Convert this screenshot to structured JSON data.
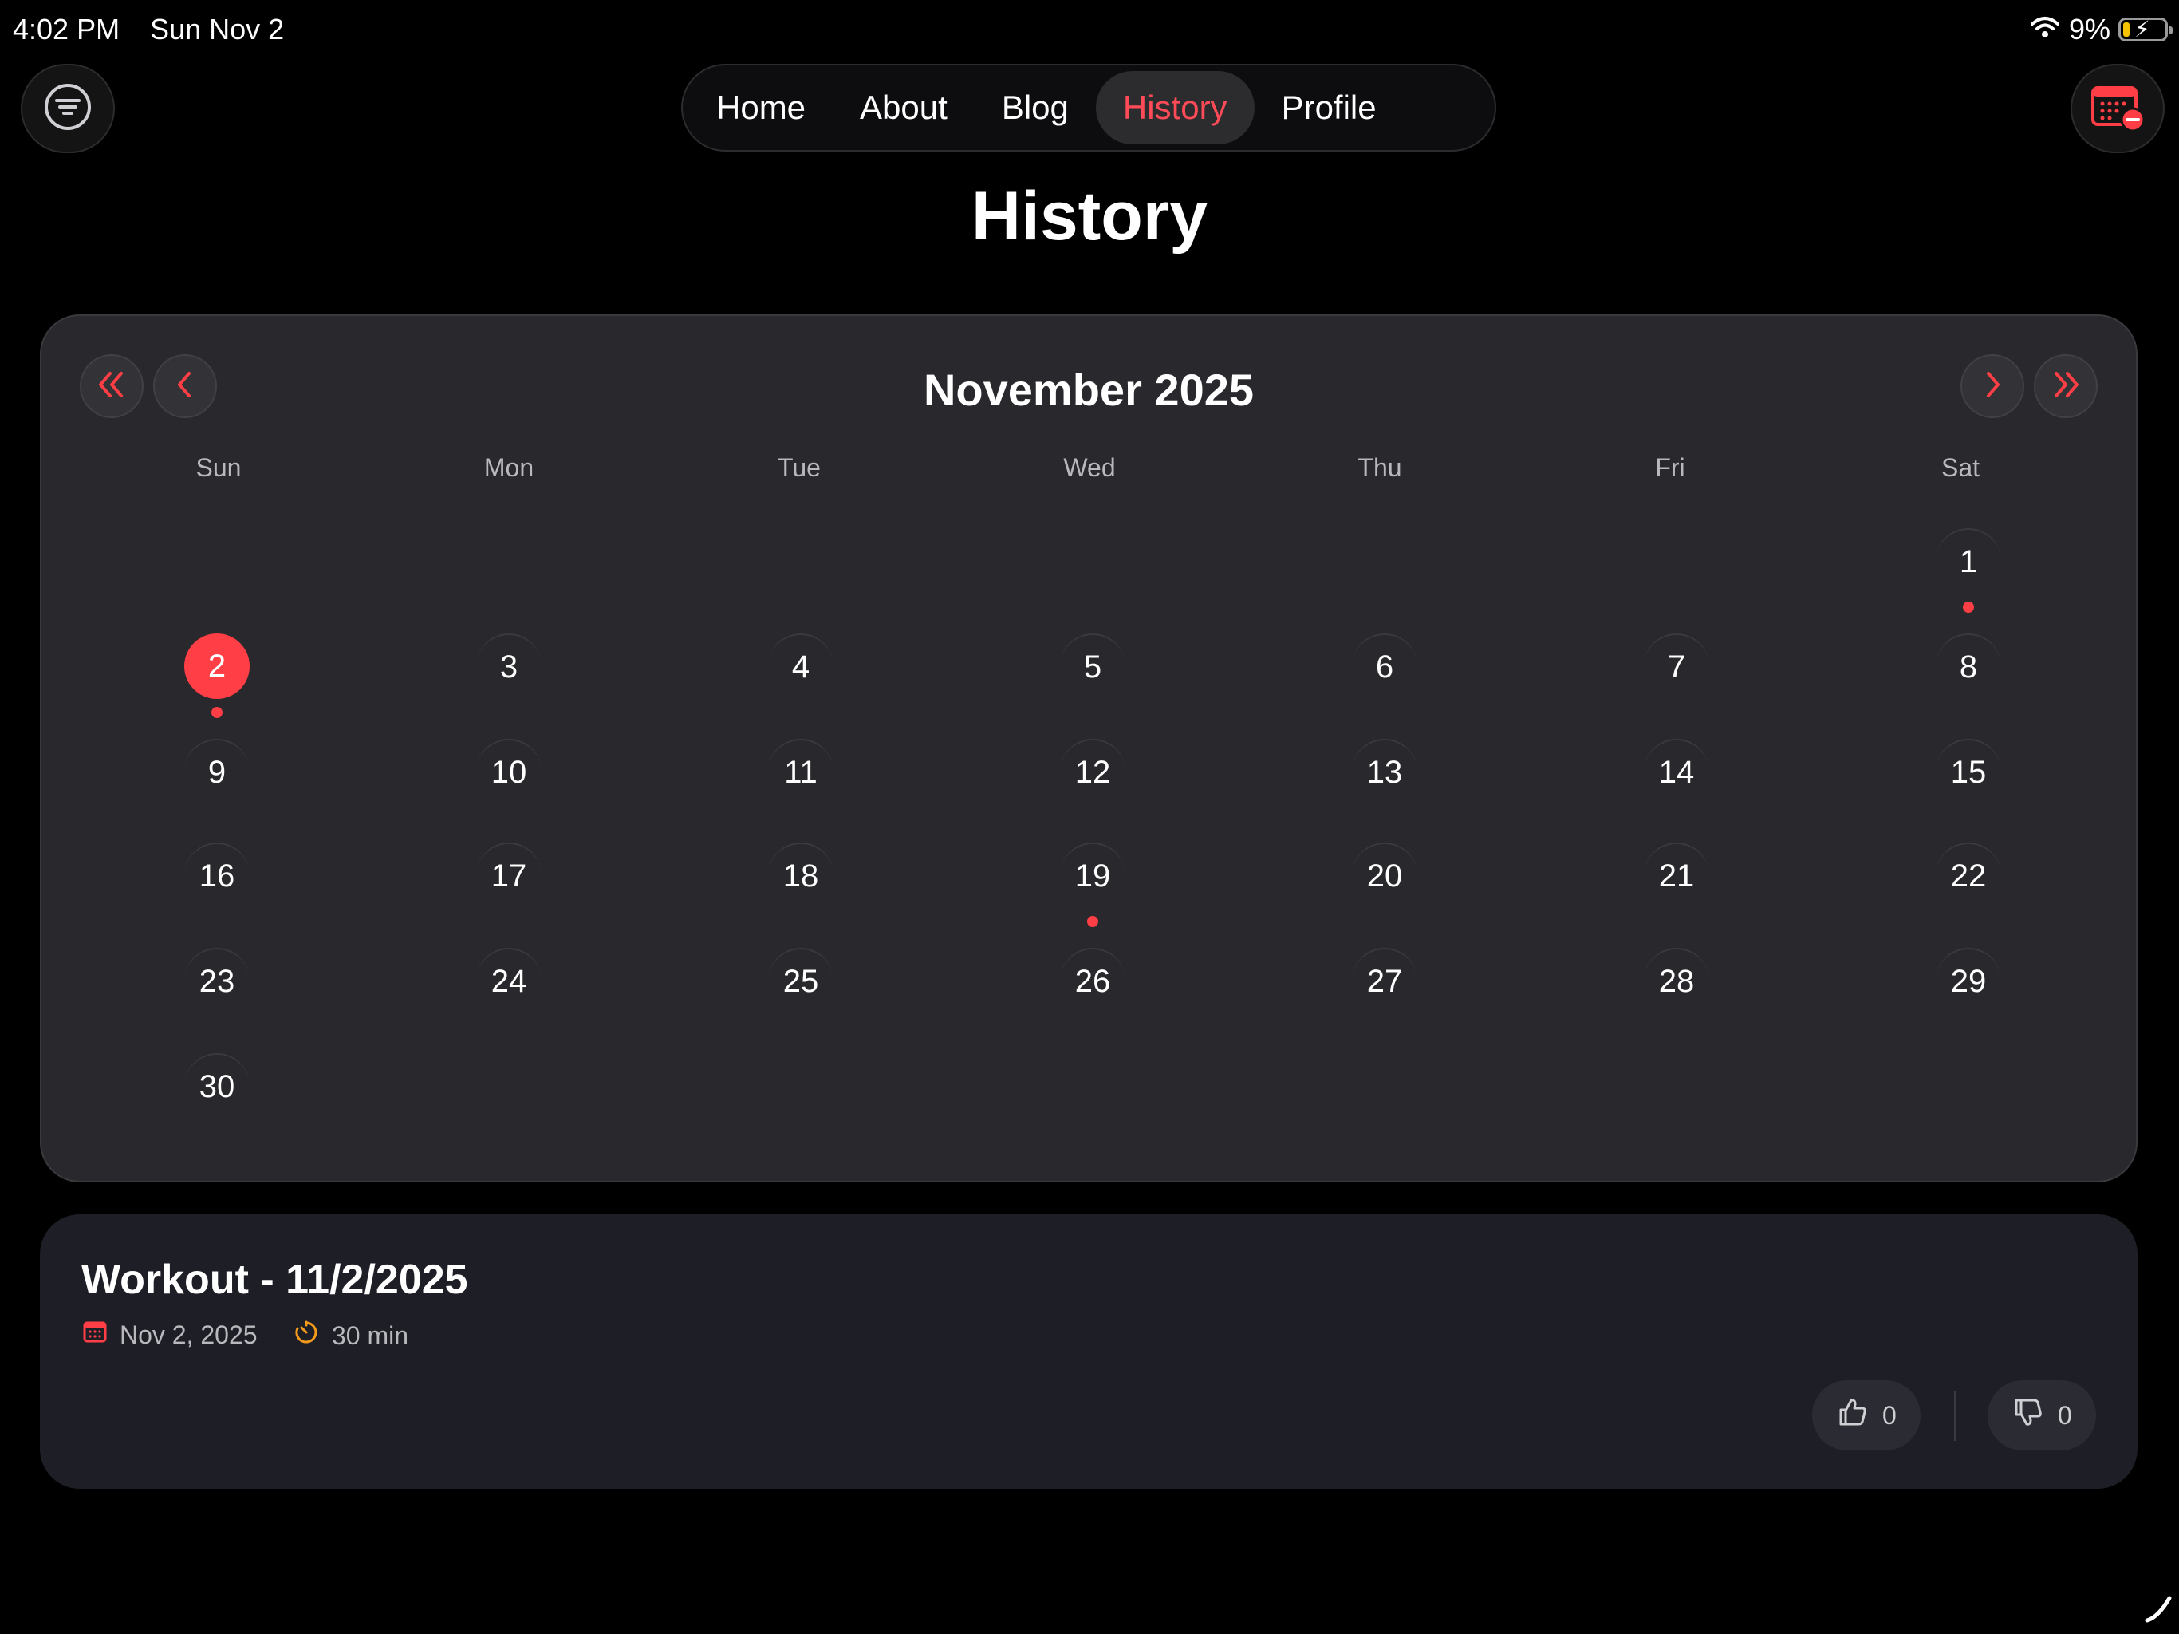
{
  "status_bar": {
    "time": "4:02 PM",
    "date": "Sun Nov 2",
    "battery": "9%"
  },
  "nav": {
    "items": [
      {
        "label": "Home"
      },
      {
        "label": "About"
      },
      {
        "label": "Blog"
      },
      {
        "label": "History"
      },
      {
        "label": "Profile"
      }
    ],
    "active": "History"
  },
  "page_title": "History",
  "calendar": {
    "month_label": "November 2025",
    "weekdays": [
      "Sun",
      "Mon",
      "Tue",
      "Wed",
      "Thu",
      "Fri",
      "Sat"
    ],
    "days": [
      "1",
      "2",
      "3",
      "4",
      "5",
      "6",
      "7",
      "8",
      "9",
      "10",
      "11",
      "12",
      "13",
      "14",
      "15",
      "16",
      "17",
      "18",
      "19",
      "20",
      "21",
      "22",
      "23",
      "24",
      "25",
      "26",
      "27",
      "28",
      "29",
      "30"
    ],
    "selected_day": "2",
    "days_with_workouts": [
      "1",
      "2",
      "19"
    ]
  },
  "workout": {
    "title": "Workout - 11/2/2025",
    "date": "Nov 2, 2025",
    "duration": "30 min",
    "likes": "0",
    "dislikes": "0"
  },
  "colors": {
    "accent": "#ff3e46",
    "background": "#000000",
    "card": "#29292d",
    "workout_card": "#1e1e26",
    "timer_icon": "#f39a1c"
  }
}
